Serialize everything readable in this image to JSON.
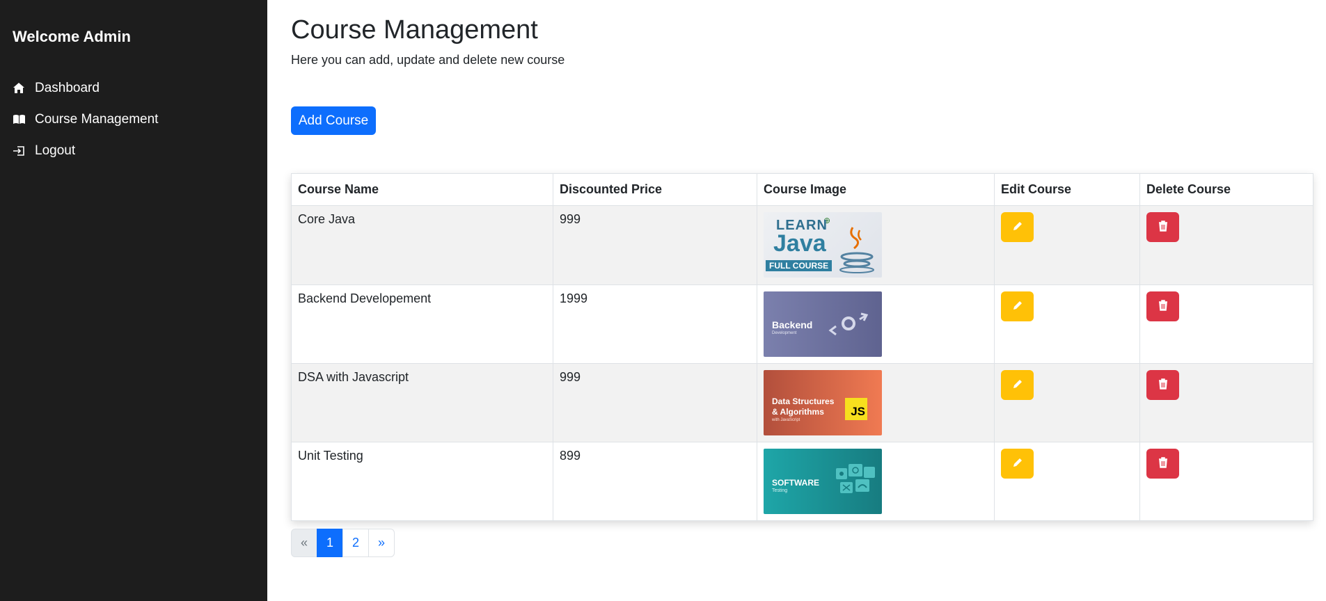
{
  "sidebar": {
    "title": "Welcome Admin",
    "items": [
      {
        "label": "Dashboard",
        "icon": "home-icon"
      },
      {
        "label": "Course Management",
        "icon": "book-icon"
      },
      {
        "label": "Logout",
        "icon": "logout-icon"
      }
    ]
  },
  "main": {
    "title": "Course Management",
    "subtitle": "Here you can add, update and delete new course",
    "add_button": "Add Course"
  },
  "table": {
    "headers": [
      "Course Name",
      "Discounted Price",
      "Course Image",
      "Edit Course",
      "Delete Course"
    ],
    "rows": [
      {
        "name": "Core Java",
        "price": "999",
        "image": {
          "line1": "LEARN",
          "line2": "Java",
          "line3": "FULL COURSE"
        }
      },
      {
        "name": "Backend Developement",
        "price": "1999",
        "image": {
          "line1": "Backend",
          "line2": "Development"
        }
      },
      {
        "name": "DSA with Javascript",
        "price": "999",
        "image": {
          "line1": "Data Structures",
          "line2": "& Algorithms",
          "line3": "with JavaScript",
          "badge": "JS"
        }
      },
      {
        "name": "Unit Testing",
        "price": "899",
        "image": {
          "line1": "SOFTWARE",
          "line2": "Testing"
        }
      }
    ]
  },
  "pagination": {
    "prev": "«",
    "pages": [
      "1",
      "2"
    ],
    "next": "»",
    "active": "1"
  },
  "colors": {
    "primary": "#0d6efd",
    "warning": "#ffc107",
    "danger": "#dc3545",
    "sidebar": "#1d1d1d"
  }
}
